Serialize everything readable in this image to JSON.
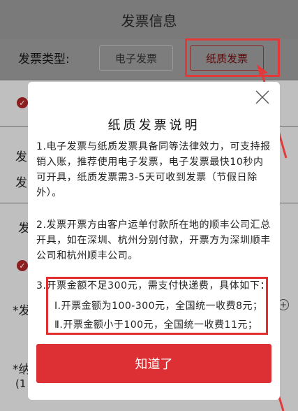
{
  "header": {
    "title": "发票信息"
  },
  "invoice_type": {
    "label": "发票类型:",
    "options": [
      "电子发票",
      "纸质发票"
    ]
  },
  "background_labels": [
    "发",
    "发",
    "发",
    "*发",
    "*纳",
    "(1"
  ],
  "modal": {
    "title": "纸质发票说明",
    "paragraphs": [
      "1.电子发票与纸质发票具备同等法律效力，可支持报销入账，推荐使用电子发票，电子发票最快10秒内可开具，纸质发票需3-5天可收到发票（节假日除外）。",
      "2.发票开票方由客户运单付款所在地的顺丰公司汇总开具，如在深圳、杭州分别付款，开票方为深圳顺丰公司和杭州顺丰公司。",
      "3.开票金额不足300元，需支付快递费，具体如下："
    ],
    "sub_items": [
      "Ⅰ.开票金额为100-300元，全国统一收费8元；",
      "Ⅱ.开票金额小于100元，全国统一收费11元；"
    ],
    "confirm_label": "知道了"
  },
  "colors": {
    "accent": "#dd3034",
    "annotation": "#e23a3a"
  }
}
